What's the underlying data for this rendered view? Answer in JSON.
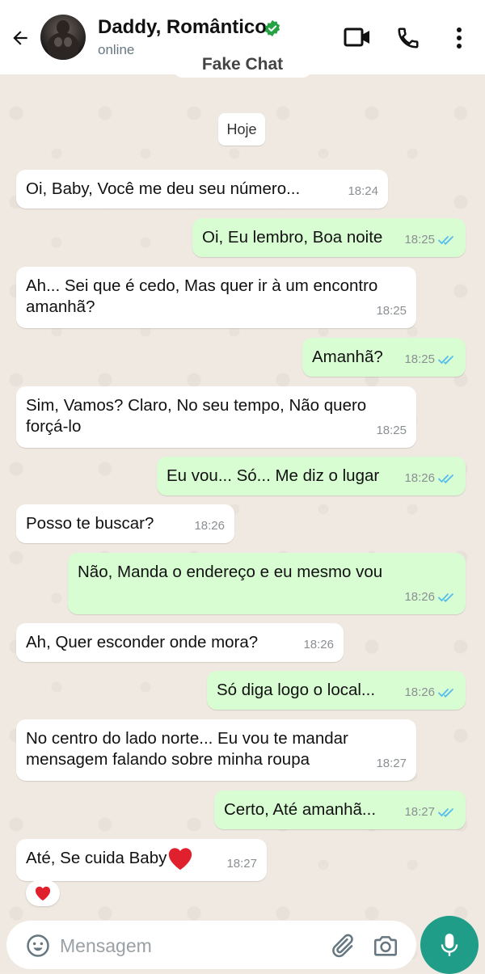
{
  "header": {
    "name": "Daddy, Romântico",
    "status": "online",
    "label": "Fake Chat",
    "verified_color": "#25a244",
    "icons": [
      "back-arrow-icon",
      "video-call-icon",
      "phone-icon",
      "more-vert-icon"
    ]
  },
  "date_chip": "Hoje",
  "messages": [
    {
      "dir": "in",
      "text": "Oi, Baby, Você me deu seu número...",
      "time": "18:24"
    },
    {
      "dir": "out",
      "text": "Oi, Eu lembro, Boa noite",
      "time": "18:25",
      "read": true
    },
    {
      "dir": "in",
      "lines": [
        "Ah... Sei que é cedo, Mas quer ir à um encontro",
        "amanhã?"
      ],
      "time": "18:25"
    },
    {
      "dir": "out",
      "text": "Amanhã?",
      "time": "18:25",
      "read": true
    },
    {
      "dir": "in",
      "lines": [
        "Sim, Vamos? Claro, No seu tempo, Não quero",
        "forçá-lo"
      ],
      "time": "18:25"
    },
    {
      "dir": "out",
      "text": "Eu vou... Só... Me diz o lugar",
      "time": "18:26",
      "read": true
    },
    {
      "dir": "in",
      "text": "Posso te buscar?",
      "time": "18:26"
    },
    {
      "dir": "out",
      "text": "Não, Manda o endereço e eu mesmo vou",
      "time": "18:26",
      "read": true
    },
    {
      "dir": "in",
      "text": "Ah, Quer esconder onde mora?",
      "time": "18:26"
    },
    {
      "dir": "out",
      "text": "Só diga logo o local...",
      "time": "18:26",
      "read": true
    },
    {
      "dir": "in",
      "lines": [
        "No centro do lado norte... Eu vou te mandar",
        "mensagem falando sobre minha roupa"
      ],
      "time": "18:27"
    },
    {
      "dir": "out",
      "text": "Certo, Até amanhã...",
      "time": "18:27",
      "read": true
    },
    {
      "dir": "in",
      "text": "Até, Se cuida Baby",
      "emoji": "red-heart",
      "time": "18:27",
      "reaction": "red-heart"
    }
  ],
  "input": {
    "placeholder": "Mensagem",
    "icons": [
      "emoji-icon",
      "attach-icon",
      "camera-icon",
      "mic-icon"
    ]
  },
  "colors": {
    "out_bubble": "#d9fdd3",
    "in_bubble": "#ffffff",
    "read_tick": "#53bdeb",
    "mic_button": "#1f9d89"
  }
}
